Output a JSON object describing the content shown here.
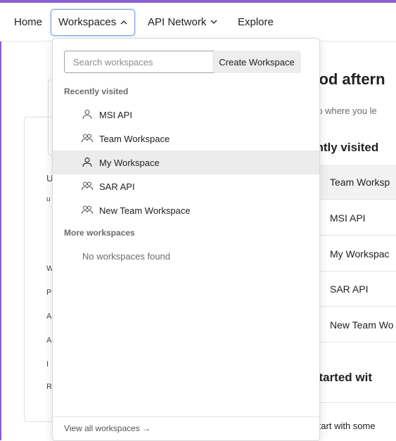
{
  "nav": {
    "home": "Home",
    "workspaces": "Workspaces",
    "workspaces_chevron": "^",
    "api_network": "API Network",
    "api_network_chevron": "v",
    "explore": "Explore"
  },
  "background": {
    "greeting": "ood aftern",
    "subtitle": "up where you le",
    "recently_visited": "ently visited",
    "rows": [
      "Team Worksp",
      "MSI API",
      "My Workspac",
      "SAR API",
      "New Team Wo"
    ],
    "get_started": "started wit",
    "start_with": "Start with some",
    "left_letters": [
      "U",
      "u",
      "W",
      "P",
      "A",
      "A",
      "I",
      "R"
    ]
  },
  "dropdown": {
    "search_placeholder": "Search workspaces",
    "search_value": "",
    "create_button": "Create Workspace",
    "recently_visited_label": "Recently visited",
    "items": [
      {
        "label": "MSI API",
        "icon": "person-icon"
      },
      {
        "label": "Team Workspace",
        "icon": "team-icon"
      },
      {
        "label": "My Workspace",
        "icon": "person-icon",
        "hovered": true
      },
      {
        "label": "SAR API",
        "icon": "team-icon"
      },
      {
        "label": "New Team Workspace",
        "icon": "team-icon"
      }
    ],
    "more_label": "More workspaces",
    "empty_message": "No workspaces found",
    "footer_link": "View all workspaces →"
  },
  "colors": {
    "accent_border": "#7aa7e8",
    "frame": "#8b5fd0",
    "hover_bg": "#ececec"
  }
}
